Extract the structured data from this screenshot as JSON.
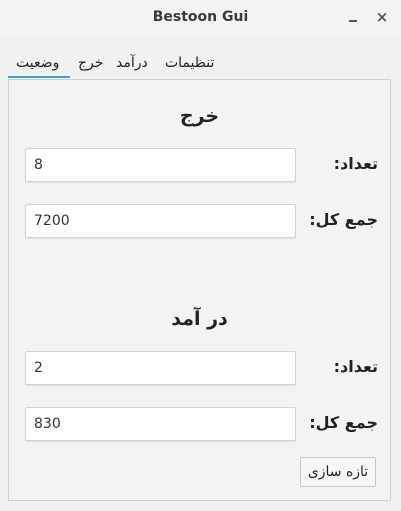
{
  "window": {
    "title": "Bestoon Gui",
    "minimize_label": "_",
    "close_label": "×"
  },
  "tabs": [
    {
      "label": "وضعیت",
      "active": true
    },
    {
      "label": "خرج",
      "active": false
    },
    {
      "label": "درآمد",
      "active": false
    },
    {
      "label": "تنظیمات",
      "active": false
    }
  ],
  "expense": {
    "title": "خرج",
    "count_label": "تعداد:",
    "count_value": "8",
    "total_label": "جمع کل:",
    "total_value": "7200"
  },
  "income": {
    "title": "در آمد",
    "count_label": "تعداد:",
    "count_value": "2",
    "total_label": "جمع کل:",
    "total_value": "830"
  },
  "actions": {
    "refresh_label": "تازه سازی"
  },
  "colors": {
    "tab_accent": "#36a2d8"
  }
}
